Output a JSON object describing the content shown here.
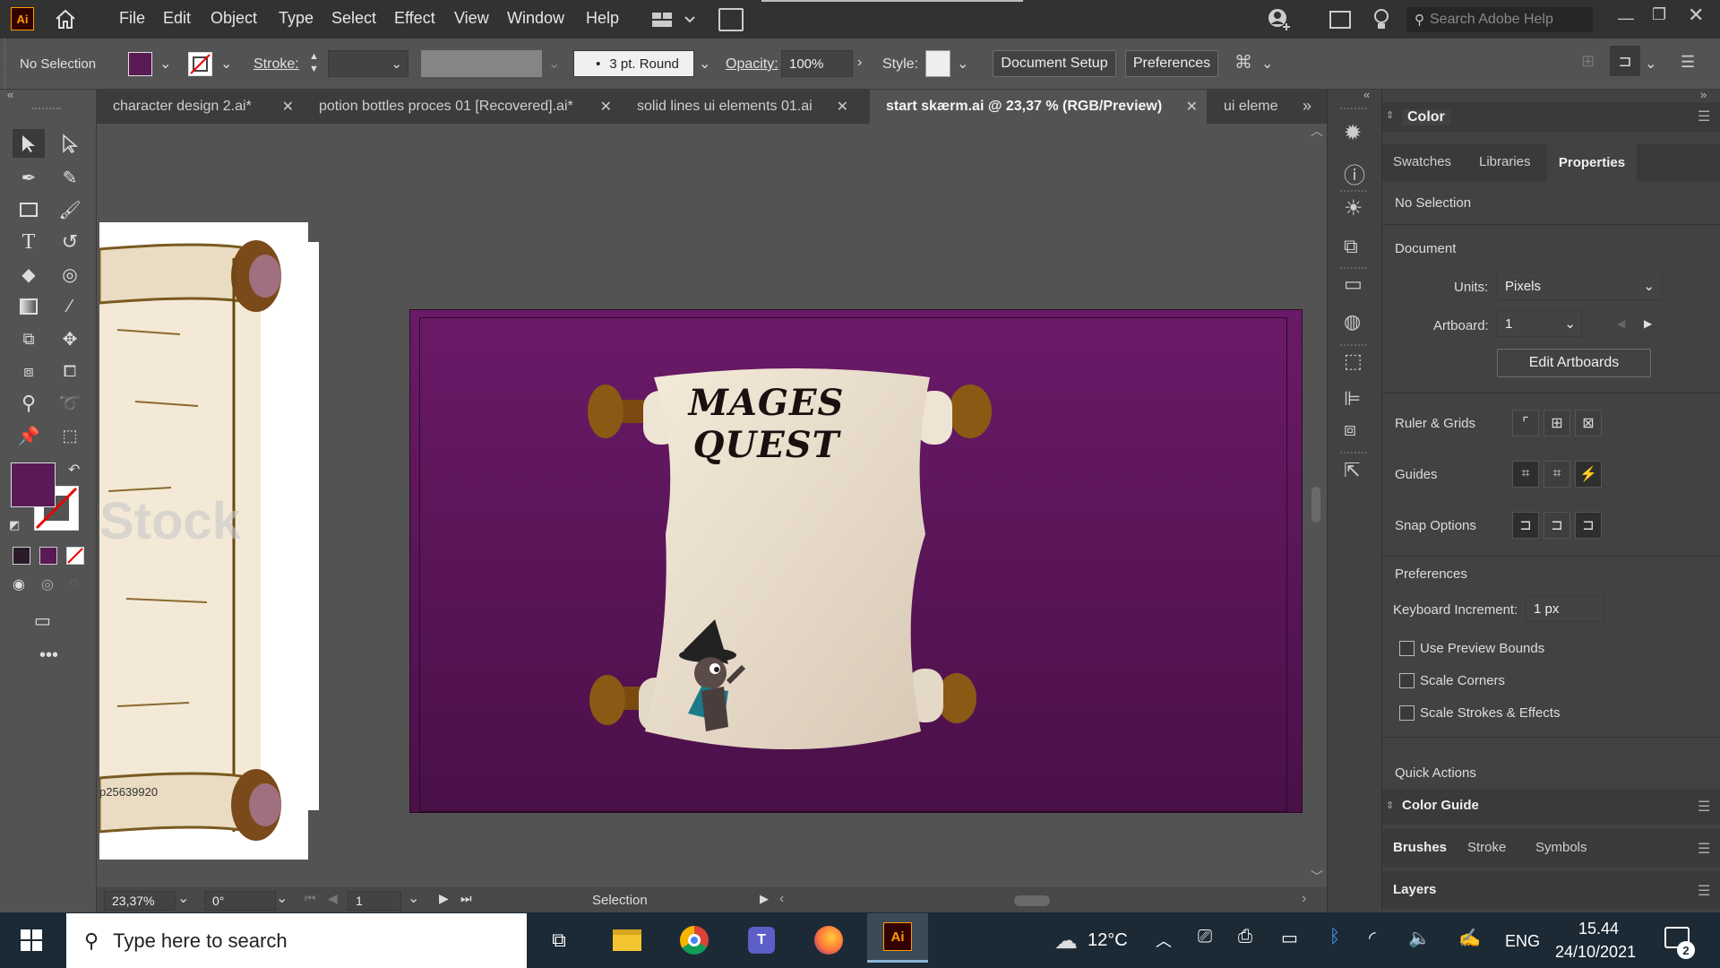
{
  "menubar": {
    "logo": "Ai",
    "menus": [
      "File",
      "Edit",
      "Object",
      "Type",
      "Select",
      "Effect",
      "View",
      "Window",
      "Help"
    ],
    "search_placeholder": "Search Adobe Help"
  },
  "control": {
    "selection": "No Selection",
    "stroke_label": "Stroke:",
    "brush": "3 pt. Round",
    "opacity_label": "Opacity:",
    "opacity_value": "100%",
    "style_label": "Style:",
    "doc_setup": "Document Setup",
    "preferences": "Preferences",
    "fill_color": "#5a1a55"
  },
  "tabs": [
    {
      "label": "character design 2.ai*"
    },
    {
      "label": "potion bottles proces 01 [Recovered].ai*"
    },
    {
      "label": "solid lines ui elements 01.ai"
    },
    {
      "label": "start skærm.ai @ 23,37 % (RGB/Preview)"
    },
    {
      "label": "ui eleme"
    }
  ],
  "artboard": {
    "title": "MAGES QUEST",
    "bg_top": "#6a1a68",
    "bg_bottom": "#4a1048"
  },
  "left_art": {
    "watermark": "Stock",
    "image_id": "p25639920"
  },
  "status": {
    "zoom": "23,37%",
    "rotation": "0°",
    "artboard_num": "1",
    "tool": "Selection"
  },
  "panel": {
    "title": "Color",
    "tabs": [
      "Swatches",
      "Libraries",
      "Properties"
    ],
    "no_selection": "No Selection",
    "document": "Document",
    "units_label": "Units:",
    "units_value": "Pixels",
    "artboard_label": "Artboard:",
    "artboard_value": "1",
    "edit_artboards": "Edit Artboards",
    "ruler_grids": "Ruler & Grids",
    "guides": "Guides",
    "snap": "Snap Options",
    "preferences": "Preferences",
    "keyboard_label": "Keyboard Increment:",
    "keyboard_value": "1 px",
    "use_preview": "Use Preview Bounds",
    "scale_corners": "Scale Corners",
    "scale_strokes": "Scale Strokes & Effects",
    "quick_actions": "Quick Actions",
    "color_guide": "Color Guide",
    "bottom_tabs": [
      "Brushes",
      "Stroke",
      "Symbols"
    ],
    "layers": "Layers"
  },
  "taskbar": {
    "search_placeholder": "Type here to search",
    "temperature": "12°C",
    "lang": "ENG",
    "time": "15.44",
    "date": "24/10/2021",
    "notifications": "2"
  }
}
